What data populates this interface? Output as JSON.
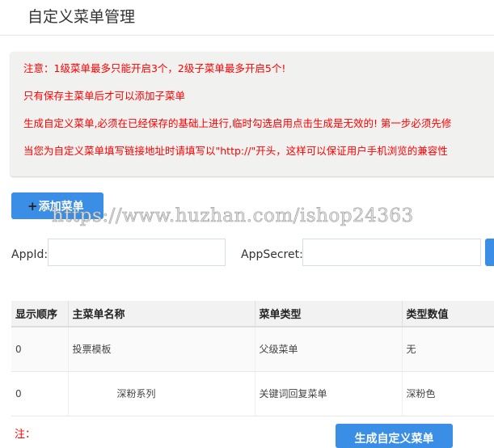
{
  "header": {
    "title": "自定义菜单管理"
  },
  "notice": {
    "lines": [
      "注意：1级菜单最多只能开启3个，2级子菜单最多开启5个!",
      "只有保存主菜单后才可以添加子菜单",
      "生成自定义菜单,必须在已经保存的基础上进行,临时勾选启用点击生成是无效的! 第一步必须先修",
      "当您为自定义菜单填写链接地址时请填写以\"http://\"开头，这样可以保证用户手机浏览的兼容性"
    ]
  },
  "toolbar": {
    "add_label": "添加菜单",
    "plus": "+"
  },
  "watermark": "https://www.huzhan.com/ishop24363",
  "form": {
    "appid_label": "AppId:",
    "appid_value": "",
    "appsecret_label": "AppSecret:",
    "appsecret_value": ""
  },
  "table": {
    "headers": [
      "显示顺序",
      "主菜单名称",
      "菜单类型",
      "类型数值"
    ],
    "rows": [
      [
        "0",
        "投票模板",
        "父级菜单",
        "无"
      ],
      [
        "0",
        "深粉系列",
        "关键词回复菜单",
        "深粉色"
      ]
    ]
  },
  "footer": {
    "note": "注：",
    "generate_label": "生成自定义菜单"
  }
}
